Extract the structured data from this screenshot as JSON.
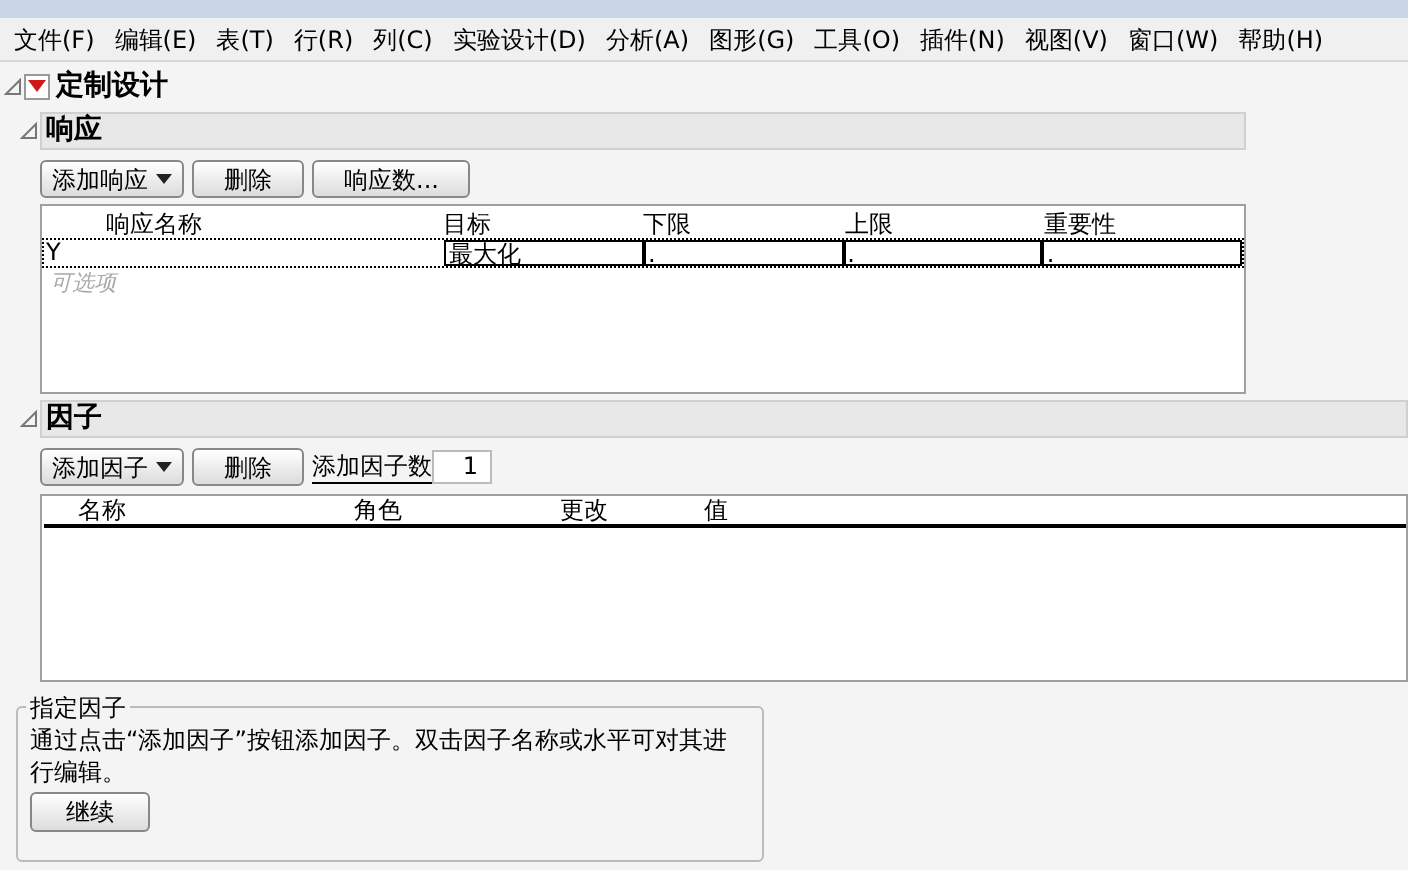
{
  "menu_bar": [
    "文件(F)",
    "编辑(E)",
    "表(T)",
    "行(R)",
    "列(C)",
    "实验设计(D)",
    "分析(A)",
    "图形(G)",
    "工具(O)",
    "插件(N)",
    "视图(V)",
    "窗口(W)",
    "帮助(H)"
  ],
  "report": {
    "title": "定制设计",
    "expanded": true
  },
  "responses": {
    "title": "响应",
    "expanded": true,
    "buttons": [
      {
        "label": "添加响应",
        "kind": "dropdown"
      },
      {
        "label": "删除",
        "kind": "plain"
      },
      {
        "label": "响应数...",
        "kind": "plain"
      }
    ],
    "columns": [
      "响应名称",
      "目标",
      "下限",
      "上限",
      "重要性"
    ],
    "rows": [
      [
        "Y",
        "最大化",
        ".",
        ".",
        "."
      ]
    ],
    "optional_hint": "可选项"
  },
  "factors": {
    "title": "因子",
    "expanded": true,
    "buttons": [
      {
        "label": "添加因子",
        "kind": "dropdown"
      },
      {
        "label": "删除",
        "kind": "plain"
      }
    ],
    "count_label": "添加因子数",
    "count_value": "1",
    "columns": [
      "名称",
      "角色",
      "更改",
      "值"
    ]
  },
  "specify_factors": {
    "title": "指定因子",
    "text": "通过点击“添加因子”按钮添加因子。双击因子名称或水平可对其进行编辑。",
    "button": "继续"
  }
}
